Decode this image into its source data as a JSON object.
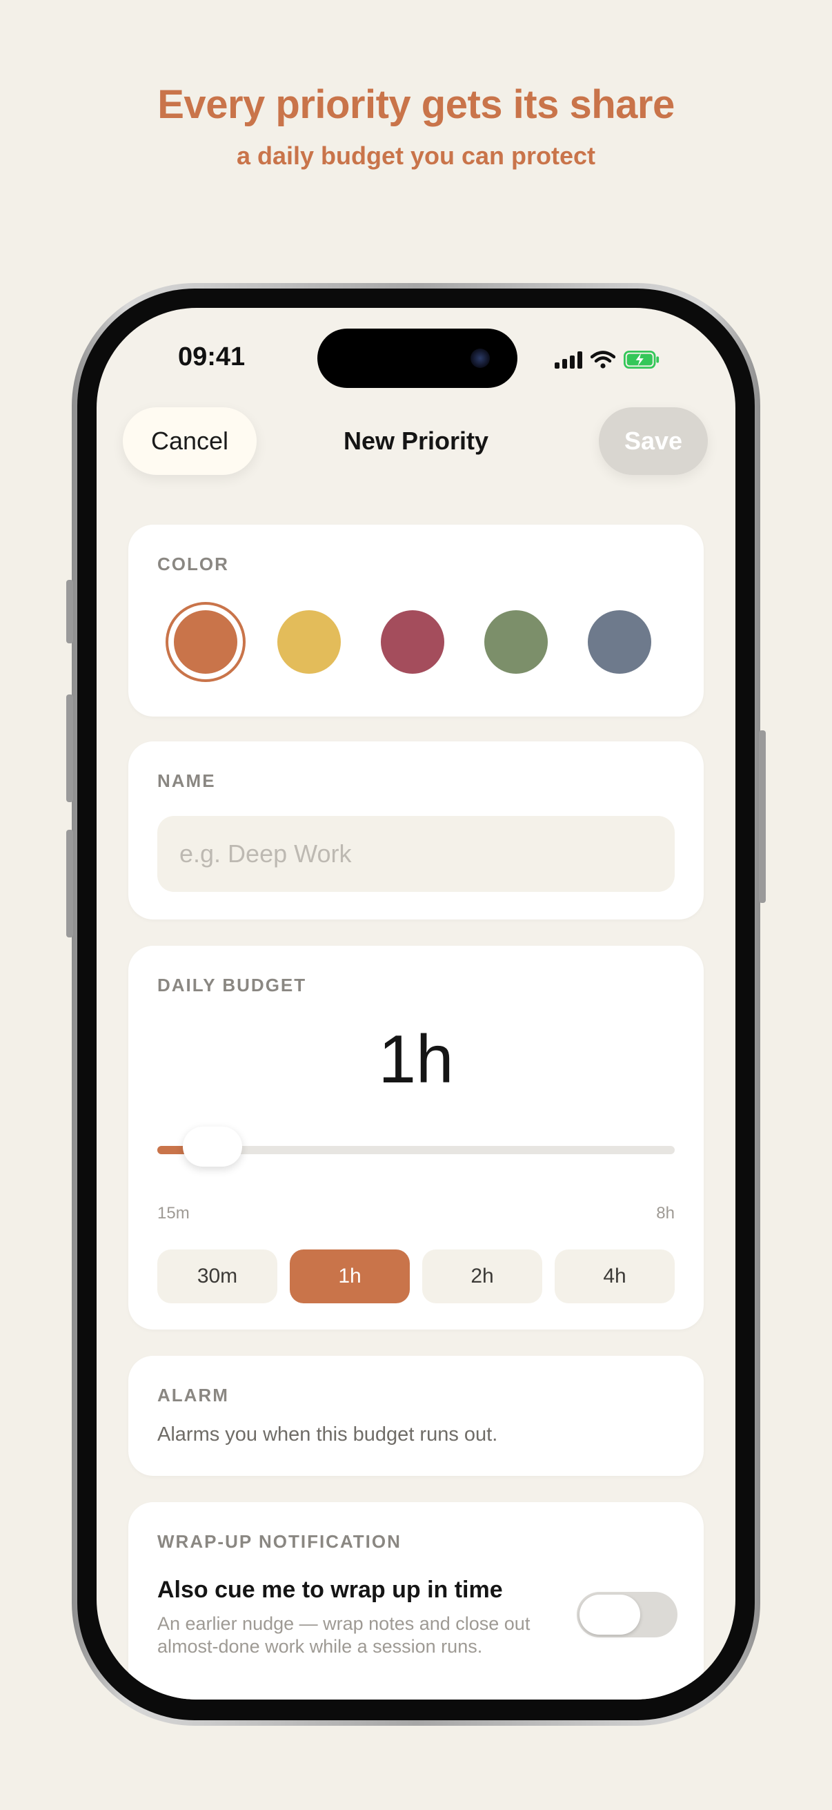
{
  "marketing": {
    "title": "Every priority gets its share",
    "subtitle": "a daily budget you can protect"
  },
  "status_bar": {
    "time": "09:41",
    "icons": [
      "cellular-signal-icon",
      "wifi-icon",
      "battery-charging-icon"
    ],
    "battery_color": "#34C759"
  },
  "nav": {
    "cancel_label": "Cancel",
    "title": "New Priority",
    "save_label": "Save"
  },
  "color_section": {
    "label": "COLOR",
    "swatches": [
      {
        "name": "terracotta",
        "hex": "#C9744A",
        "selected": true
      },
      {
        "name": "mustard",
        "hex": "#E3BC5A",
        "selected": false
      },
      {
        "name": "raspberry",
        "hex": "#A44D5C",
        "selected": false
      },
      {
        "name": "sage",
        "hex": "#7C8F6A",
        "selected": false
      },
      {
        "name": "slate",
        "hex": "#6E7A8C",
        "selected": false
      }
    ]
  },
  "name_section": {
    "label": "NAME",
    "placeholder": "e.g. Deep Work",
    "value": ""
  },
  "budget_section": {
    "label": "DAILY BUDGET",
    "value_display": "1h",
    "min_label": "15m",
    "max_label": "8h",
    "slider_fraction": 0.107,
    "presets": [
      "30m",
      "1h",
      "2h",
      "4h"
    ],
    "active_preset": "1h"
  },
  "alarm_section": {
    "label": "ALARM",
    "description": "Alarms you when this budget runs out."
  },
  "wrapup_section": {
    "label": "WRAP-UP NOTIFICATION",
    "title": "Also cue me to wrap up in time",
    "description": "An earlier nudge — wrap notes and close out almost-done work while a session runs.",
    "toggle_on": false
  },
  "colors": {
    "accent": "#C9744A",
    "background": "#F3F0E8",
    "card": "#FFFFFF",
    "save_disabled": "#D9D6D0"
  }
}
